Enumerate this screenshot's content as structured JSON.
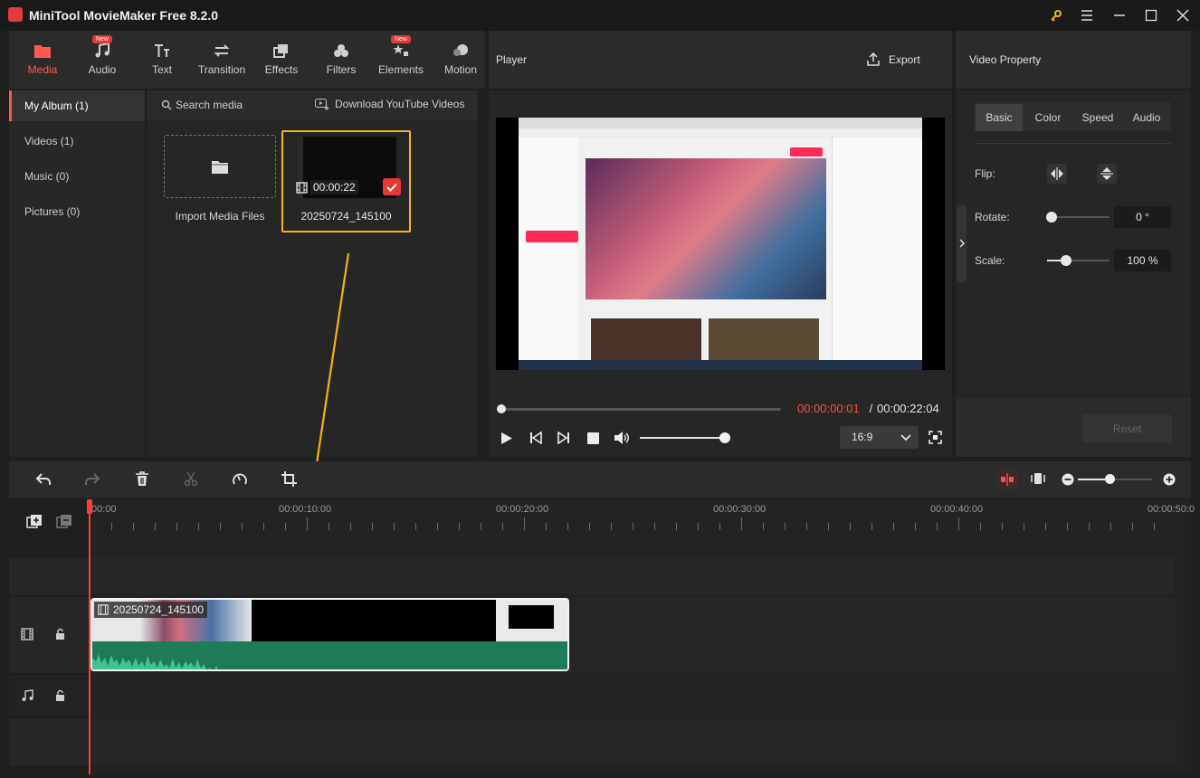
{
  "app": {
    "title": "MiniTool MovieMaker Free 8.2.0"
  },
  "toolbar": {
    "items": [
      {
        "label": "Media",
        "icon": "folder-icon",
        "active": true
      },
      {
        "label": "Audio",
        "icon": "music-note-icon",
        "badge": "New"
      },
      {
        "label": "Text",
        "icon": "text-icon"
      },
      {
        "label": "Transition",
        "icon": "transition-arrows-icon"
      },
      {
        "label": "Effects",
        "icon": "effects-icon"
      },
      {
        "label": "Filters",
        "icon": "filters-icon"
      },
      {
        "label": "Elements",
        "icon": "elements-icon",
        "badge": "New"
      },
      {
        "label": "Motion",
        "icon": "motion-icon"
      }
    ]
  },
  "sidebar": {
    "items": [
      {
        "label": "My Album (1)"
      },
      {
        "label": "Videos (1)"
      },
      {
        "label": "Music (0)"
      },
      {
        "label": "Pictures (0)"
      }
    ]
  },
  "media": {
    "search_label": "Search media",
    "download_label": "Download YouTube Videos",
    "import_label": "Import Media Files",
    "clip_name": "20250724_145100",
    "clip_duration": "00:00:22"
  },
  "player": {
    "title": "Player",
    "export_label": "Export",
    "current_time": "00:00:00:01",
    "separator": " / ",
    "total_time": "00:00:22:04",
    "aspect": "16:9",
    "progress": 0.0
  },
  "property": {
    "title": "Video Property",
    "tabs": [
      "Basic",
      "Color",
      "Speed",
      "Audio"
    ],
    "active_tab": "Basic",
    "flip_label": "Flip:",
    "rotate_label": "Rotate:",
    "rotate_value": "0 °",
    "scale_label": "Scale:",
    "scale_value": "100 %",
    "reset_label": "Reset"
  },
  "timeline": {
    "ruler": [
      "00:00",
      "00:00:10:00",
      "00:00:20:00",
      "00:00:30:00",
      "00:00:40:00",
      "00:00:50:0"
    ],
    "clip_label": "20250724_145100"
  },
  "colors": {
    "accent": "#ff5a4f",
    "highlight": "#f5b21b",
    "audio": "#1f7a57"
  }
}
